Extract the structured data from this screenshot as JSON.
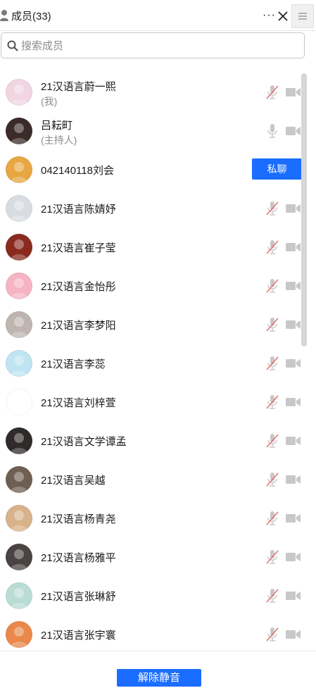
{
  "header": {
    "title": "成员(33)",
    "more_label": "···"
  },
  "search": {
    "placeholder": "搜索成员"
  },
  "colors": {
    "accent": "#1a6dff",
    "muted_mic": "#e86f6f",
    "icon_gray": "#c8c8c8"
  },
  "members": [
    {
      "name": "21汉语言蔚一熙",
      "sub": "(我)",
      "mic": "muted",
      "avatar_color": "#f1d6e2"
    },
    {
      "name": "吕耘町",
      "sub": "(主持人)",
      "mic": "on",
      "avatar_color": "#3b2b29"
    },
    {
      "name": "042140118刘会",
      "sub": "",
      "mic": "none",
      "action": "私聊",
      "avatar_color": "#e8a743"
    },
    {
      "name": "21汉语言陈婧妤",
      "sub": "",
      "mic": "muted",
      "avatar_color": "#d9dde2"
    },
    {
      "name": "21汉语言崔子莹",
      "sub": "",
      "mic": "muted",
      "avatar_color": "#8a2a1e"
    },
    {
      "name": "21汉语言金怡彤",
      "sub": "",
      "mic": "muted",
      "avatar_color": "#f5b3c3"
    },
    {
      "name": "21汉语言李梦阳",
      "sub": "",
      "mic": "muted",
      "avatar_color": "#bfb5b0"
    },
    {
      "name": "21汉语言李蕊",
      "sub": "",
      "mic": "muted",
      "avatar_color": "#bfe4f2"
    },
    {
      "name": "21汉语言刘梓萱",
      "sub": "",
      "mic": "muted",
      "avatar_color": "#ffffff"
    },
    {
      "name": "21汉语言文学谭孟",
      "sub": "",
      "mic": "muted",
      "avatar_color": "#2f2b2a"
    },
    {
      "name": "21汉语言吴越",
      "sub": "",
      "mic": "muted",
      "avatar_color": "#6e5f52"
    },
    {
      "name": "21汉语言杨青尧",
      "sub": "",
      "mic": "muted",
      "avatar_color": "#d8b28a"
    },
    {
      "name": "21汉语言杨雅平",
      "sub": "",
      "mic": "muted",
      "avatar_color": "#4b4343"
    },
    {
      "name": "21汉语言张琳舒",
      "sub": "",
      "mic": "muted",
      "avatar_color": "#b9ddd4"
    },
    {
      "name": "21汉语言张宇寰",
      "sub": "",
      "mic": "muted",
      "avatar_color": "#e9884a"
    }
  ],
  "footer": {
    "unmute_label": "解除静音"
  }
}
